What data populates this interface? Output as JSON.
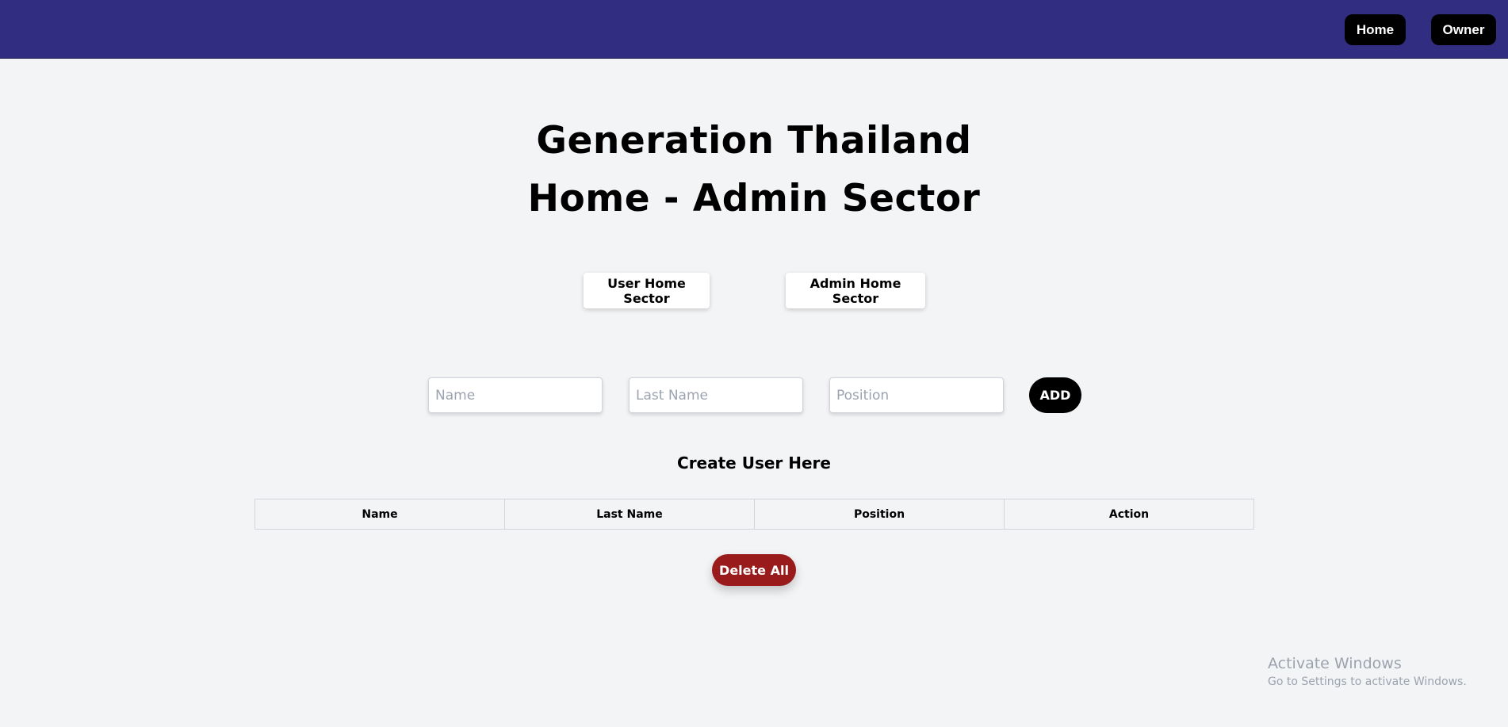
{
  "navbar": {
    "home_label": "Home",
    "owner_label": "Owner"
  },
  "header": {
    "title_line1": "Generation Thailand",
    "title_line2": "Home - Admin Sector"
  },
  "sectors": {
    "user_label": "User Home Sector",
    "admin_label": "Admin Home Sector"
  },
  "form": {
    "name_placeholder": "Name",
    "lastname_placeholder": "Last Name",
    "position_placeholder": "Position",
    "add_label": "ADD"
  },
  "section_title": "Create User Here",
  "table": {
    "columns": [
      "Name",
      "Last Name",
      "Position",
      "Action"
    ]
  },
  "delete_all_label": "Delete All",
  "watermark": {
    "line1": "Activate Windows",
    "line2": "Go to Settings to activate Windows."
  },
  "colors": {
    "navbar": "#312e81",
    "background": "#f3f4f6",
    "delete": "#991b1b"
  }
}
